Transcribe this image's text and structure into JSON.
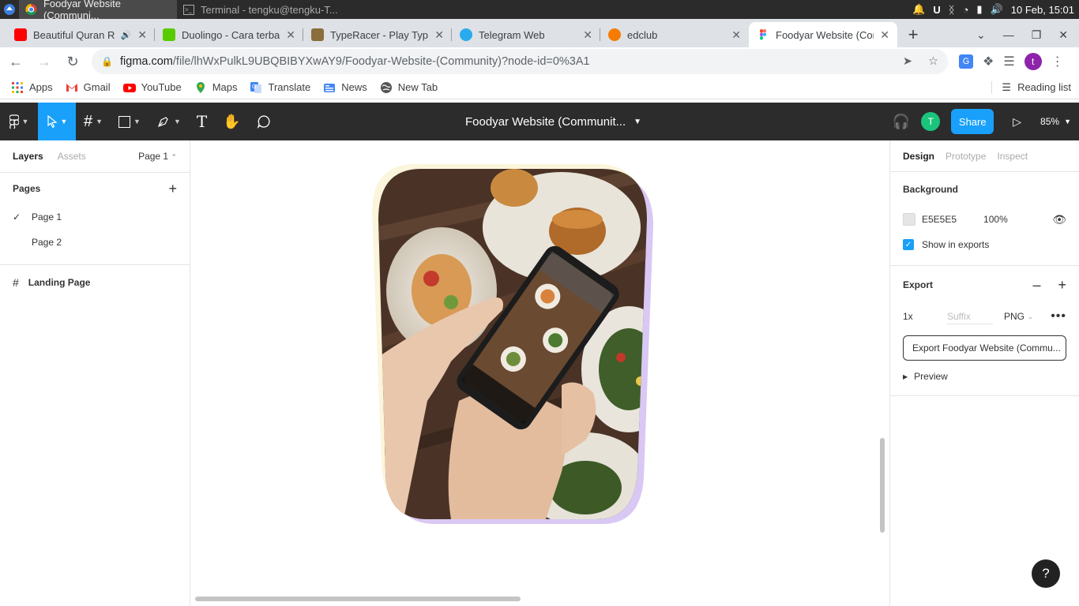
{
  "os_bar": {
    "active_task": "Foodyar Website (Communi...",
    "inactive_task": "Terminal - tengku@tengku-T...",
    "datetime": "10 Feb, 15:01"
  },
  "tabs": [
    {
      "title": "Beautiful Quran Re",
      "favicon_color": "#ff0000",
      "icon": "youtube-icon"
    },
    {
      "title": "Duolingo - Cara terbaik",
      "favicon_color": "#58cc02",
      "icon": "duolingo-icon"
    },
    {
      "title": "TypeRacer - Play Typing",
      "favicon_color": "#8a6d3b",
      "icon": "typeracer-icon"
    },
    {
      "title": "Telegram Web",
      "favicon_color": "#2aabee",
      "icon": "telegram-icon"
    },
    {
      "title": "edclub",
      "favicon_color": "#f57c00",
      "icon": "edclub-icon"
    },
    {
      "title": "Foodyar Website (Com",
      "favicon_color": "#f24e1e",
      "icon": "figma-icon"
    }
  ],
  "address": {
    "host": "figma.com",
    "path": "/file/lhWxPulkL9UBQBIBYXwAY9/Foodyar-Website-(Community)?node-id=0%3A1"
  },
  "bookmarks": [
    {
      "label": "Apps",
      "icon": "apps-grid-icon"
    },
    {
      "label": "Gmail",
      "icon": "gmail-icon"
    },
    {
      "label": "YouTube",
      "icon": "youtube-icon"
    },
    {
      "label": "Maps",
      "icon": "maps-icon"
    },
    {
      "label": "Translate",
      "icon": "translate-icon"
    },
    {
      "label": "News",
      "icon": "news-icon"
    },
    {
      "label": "New Tab",
      "icon": "globe-icon"
    }
  ],
  "reading_list": "Reading list",
  "figma": {
    "file_title": "Foodyar Website (Communit...",
    "user_initial": "T",
    "profile_initial": "t",
    "share_label": "Share",
    "zoom": "85%"
  },
  "left_panel": {
    "tab_layers": "Layers",
    "tab_assets": "Assets",
    "current_page": "Page 1",
    "pages_heading": "Pages",
    "pages": [
      "Page 1",
      "Page 2"
    ],
    "layers": [
      "Landing Page"
    ]
  },
  "right_panel": {
    "tab_design": "Design",
    "tab_prototype": "Prototype",
    "tab_inspect": "Inspect",
    "background_heading": "Background",
    "bg_hex": "E5E5E5",
    "bg_opacity": "100%",
    "show_in_exports": "Show in exports",
    "export_heading": "Export",
    "export_scale": "1x",
    "export_suffix_placeholder": "Suffix",
    "export_format": "PNG",
    "export_button": "Export Foodyar Website (Commu...",
    "preview_label": "Preview"
  },
  "help_label": "?"
}
